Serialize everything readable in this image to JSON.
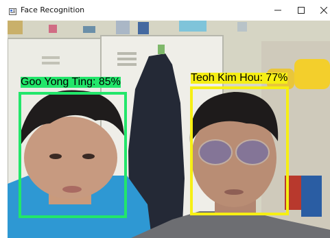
{
  "window": {
    "title": "Face Recognition",
    "controls": [
      "minimize",
      "maximize",
      "close"
    ]
  },
  "detections": [
    {
      "name": "Goo Yong Ting",
      "confidence": "85%",
      "label": "Goo Yong Ting: 85%",
      "box_color": "#22e66a"
    },
    {
      "name": "Teoh Kim Hou",
      "confidence": "77%",
      "label": "Teoh Kim Hou: 77%",
      "box_color": "#f6ef14"
    }
  ],
  "colors": {
    "wall": "#dad8c8",
    "locker": "#efefe8",
    "jacket": "#252a36",
    "shirt_left": "#2e99d6",
    "shirt_right": "#6e6f73"
  }
}
